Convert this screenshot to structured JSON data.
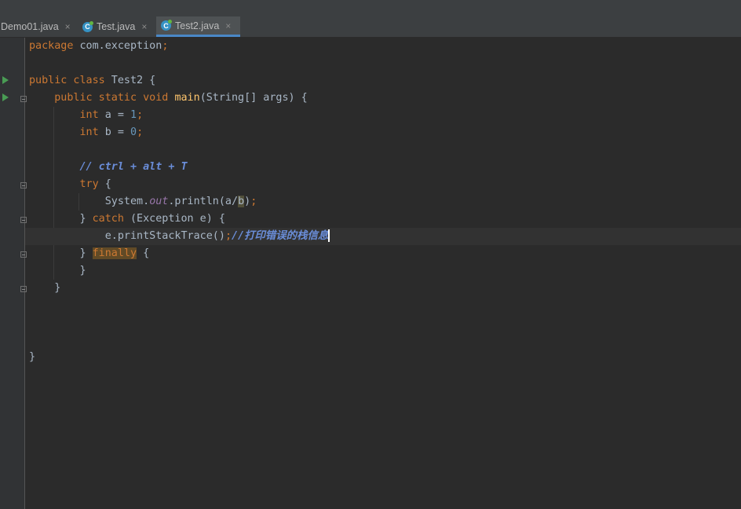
{
  "tabs": [
    {
      "label": "Demo01.java",
      "active": false
    },
    {
      "label": "Test.java",
      "active": false
    },
    {
      "label": "Test2.java",
      "active": true
    }
  ],
  "tab_close": "×",
  "file_icon_letter": "C",
  "code": {
    "l1": {
      "kw": "package",
      "rest": " com.exception",
      "semi": ";"
    },
    "l3": {
      "kw": "public class",
      "rest": " Test2 {"
    },
    "l4": {
      "kw": "public static void",
      "fn": "main",
      "rest": "(String[] args) {"
    },
    "l5": {
      "kw": "int",
      "rest": " a = ",
      "num": "1",
      "semi": ";"
    },
    "l6": {
      "kw": "int",
      "rest": " b = ",
      "num": "0",
      "semi": ";"
    },
    "l8": {
      "comment": "// ctrl + alt + T"
    },
    "l9": {
      "kw": "try",
      "rest": " {"
    },
    "l10": {
      "pre": "System.",
      "field": "out",
      "mid": ".println(a/",
      "hl": "b",
      "post": ")",
      "semi": ";"
    },
    "l11": {
      "pre": "} ",
      "kw": "catch",
      "rest": " (Exception e) {"
    },
    "l12": {
      "pre": "e.printStackTrace()",
      "semi": ";",
      "comment": "//打印错误的栈信息"
    },
    "l13": {
      "pre": "} ",
      "kw": "finally",
      "rest": " {"
    },
    "l14": {
      "text": "}"
    },
    "l15": {
      "text": "}"
    },
    "l19": {
      "text": "}"
    }
  },
  "colors": {
    "background": "#2b2b2b",
    "keyword": "#cc7832",
    "number": "#6897bb",
    "method": "#ffc66d",
    "comment": "#6a8dd9",
    "static_field": "#9876aa",
    "run_marker": "#499c54",
    "tab_underline": "#4a88c7"
  },
  "icons": [
    "java-class-icon",
    "close-icon",
    "run-gutter-icon",
    "fold-icon"
  ]
}
